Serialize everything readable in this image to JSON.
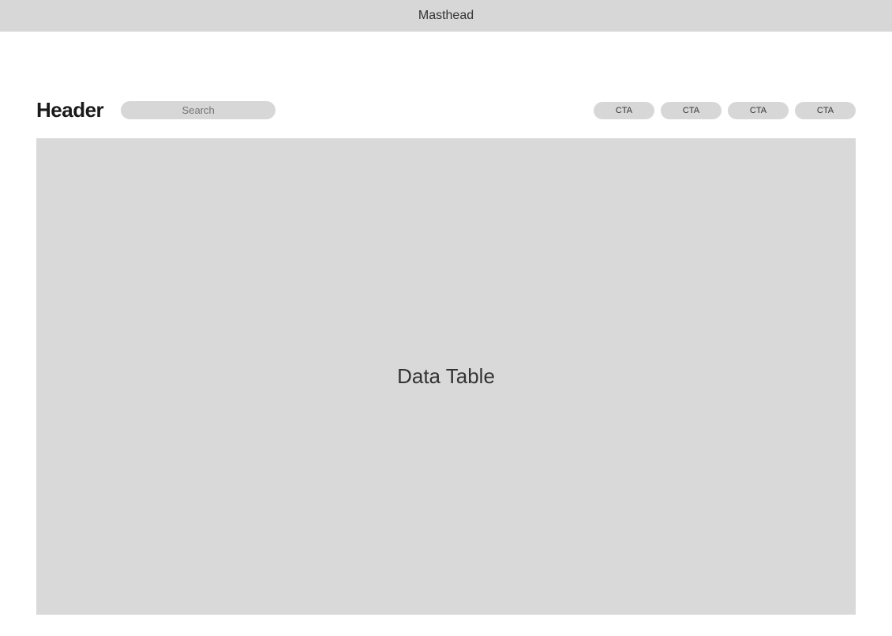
{
  "masthead": {
    "label": "Masthead"
  },
  "header": {
    "title": "Header",
    "search_placeholder": "Search",
    "ctas": [
      {
        "label": "CTA"
      },
      {
        "label": "CTA"
      },
      {
        "label": "CTA"
      },
      {
        "label": "CTA"
      }
    ]
  },
  "main": {
    "data_table_label": "Data Table"
  }
}
